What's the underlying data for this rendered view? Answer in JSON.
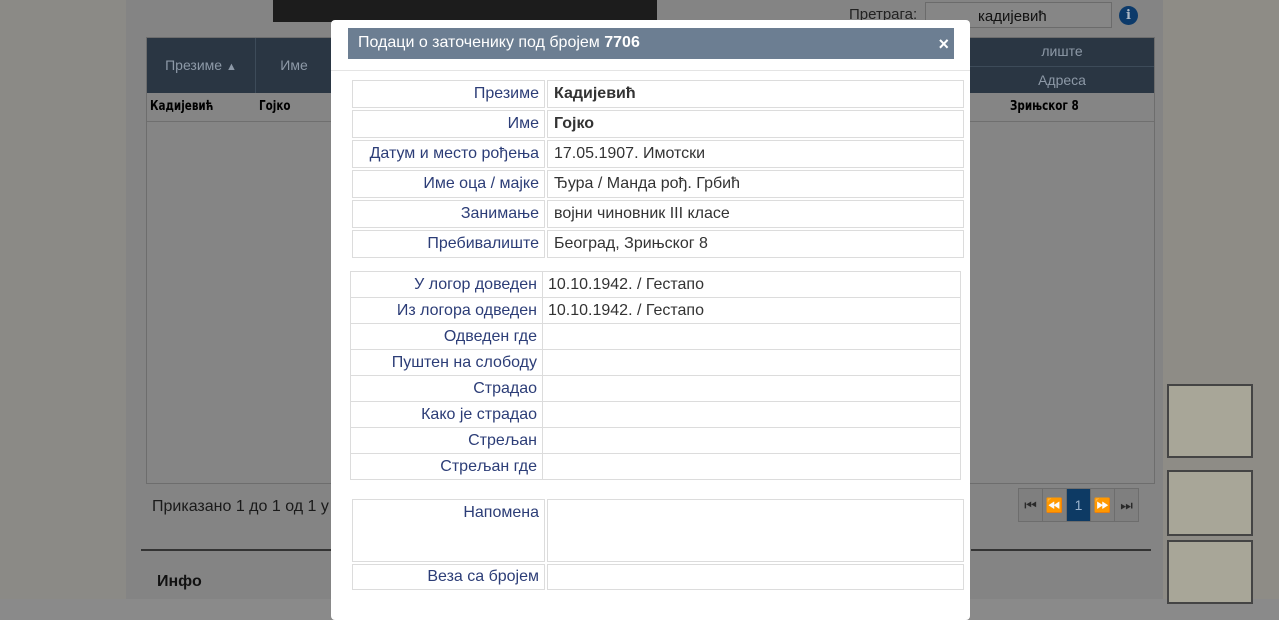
{
  "search": {
    "label": "Претрага:",
    "value": "кадијевић"
  },
  "grid": {
    "headers": [
      "Презиме",
      "Име"
    ],
    "right_header_top": "лиште",
    "right_header_bottom": "Адреса",
    "row": {
      "surname": "Кадијевић",
      "name": "Гојко",
      "address": "Зрињског 8"
    }
  },
  "status": "Приказано 1 до 1 од 1 у",
  "pager": {
    "current": "1"
  },
  "info_heading": "Инфо",
  "modal": {
    "title_prefix": "Подаци о заточенику под бројем",
    "number": "7706",
    "close": "×",
    "personal": [
      {
        "label": "Презиме",
        "value": "Кадијевић"
      },
      {
        "label": "Име",
        "value": "Гојко"
      },
      {
        "label": "Датум и место рођења",
        "value": "17.05.1907.  Имотски"
      },
      {
        "label": "Име оца / мајке",
        "value": "Ђура / Манда рођ. Грбић"
      },
      {
        "label": "Занимање",
        "value": "војни чиновник III класе"
      },
      {
        "label": "Пребивалиште",
        "value": "Београд, Зрињског 8"
      }
    ],
    "camp": [
      {
        "label": "У логор доведен",
        "value": "10.10.1942. / Гестапо"
      },
      {
        "label": "Из логора одведен",
        "value": "10.10.1942. / Гестапо"
      },
      {
        "label": "Одведен где",
        "value": ""
      },
      {
        "label": "Пуштен на слободу",
        "value": ""
      },
      {
        "label": "Страдао",
        "value": ""
      },
      {
        "label": "Како је страдао",
        "value": ""
      },
      {
        "label": "Стрељан",
        "value": ""
      },
      {
        "label": "Стрељан где",
        "value": ""
      }
    ],
    "note_label": "Напомена",
    "link_label": "Веза са бројем"
  }
}
